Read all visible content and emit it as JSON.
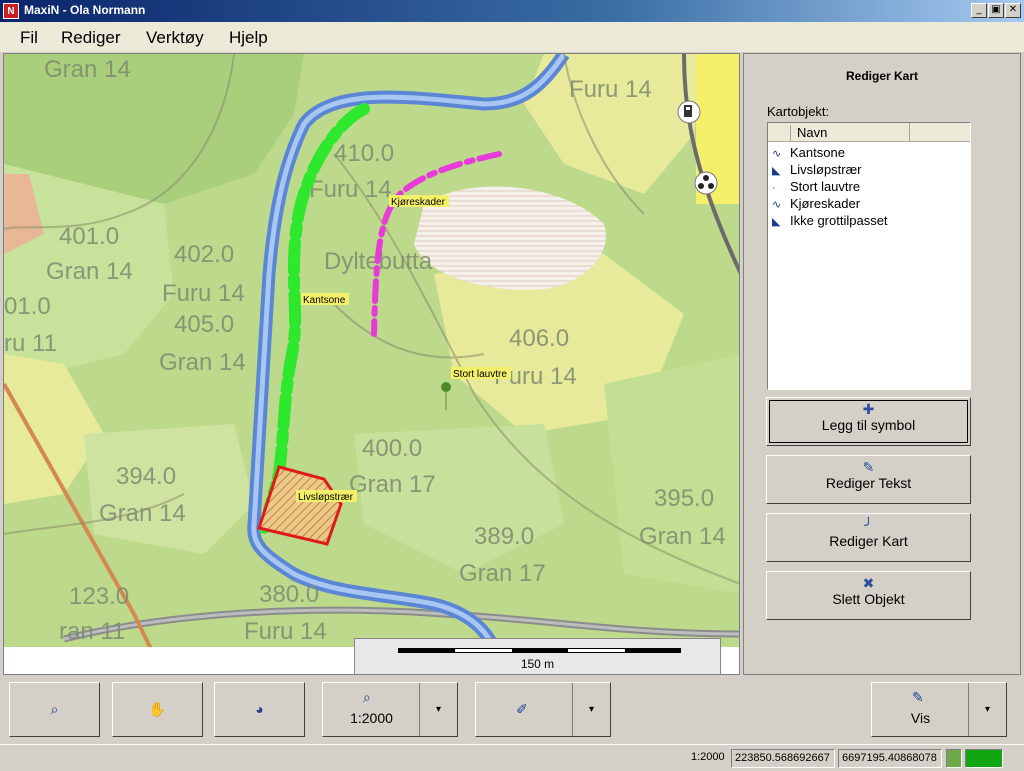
{
  "window": {
    "title": "MaxiN - Ola Normann",
    "app_icon": "N",
    "controls": [
      "_",
      "▣",
      "✕"
    ]
  },
  "menu": {
    "items": [
      "Fil",
      "Rediger",
      "Verktøy",
      "Hjelp"
    ]
  },
  "map": {
    "labels": [
      "Gran 14",
      "Furu 14",
      "410.0",
      "Furu 14",
      "401.0",
      "402.0",
      "Gran 14",
      "Furu 14",
      "01.0",
      "405.0",
      "ru 11",
      "Gran 14",
      "Dyltebutta",
      "406.0",
      "Furu 14",
      "400.0",
      "Gran 17",
      "394.0",
      "Gran 14",
      "395.0",
      "Gran 14",
      "389.0",
      "Gran 17",
      "123.0",
      "380.0",
      "Furu 14",
      "ran 11"
    ],
    "features": {
      "kantsone": "Kantsone",
      "kjoreskader": "Kjøreskader",
      "stort_lauvtre": "Stort lauvtre",
      "livslopstraer": "Livsløpstrær"
    },
    "scale_label": "150 m"
  },
  "panel": {
    "title": "Rediger Kart",
    "objects_label": "Kartobjekt:",
    "list_header": "Navn",
    "items": [
      {
        "icon": "line-icon",
        "glyph": "∿",
        "label": "Kantsone"
      },
      {
        "icon": "polygon-icon",
        "glyph": "◣",
        "label": "Livsløpstrær"
      },
      {
        "icon": "point-icon",
        "glyph": "·",
        "label": "Stort lauvtre"
      },
      {
        "icon": "line-icon",
        "glyph": "∿",
        "label": "Kjøreskader"
      },
      {
        "icon": "polygon-icon",
        "glyph": "◣",
        "label": "Ikke grottilpasset"
      }
    ],
    "buttons": [
      {
        "icon": "plus-icon",
        "glyph": "✚",
        "label": "Legg til symbol"
      },
      {
        "icon": "edit-text-icon",
        "glyph": "✎",
        "label": "Rediger Tekst"
      },
      {
        "icon": "edit-map-icon",
        "glyph": "╯",
        "label": "Rediger Kart"
      },
      {
        "icon": "delete-object-icon",
        "glyph": "✖",
        "label": "Slett Objekt"
      }
    ]
  },
  "toolbar": {
    "zoom_label": "1:2000",
    "view_label": "Vis"
  },
  "status": {
    "scale": "1:2000",
    "x": "223850.568692667",
    "y": "6697195.40868078"
  }
}
